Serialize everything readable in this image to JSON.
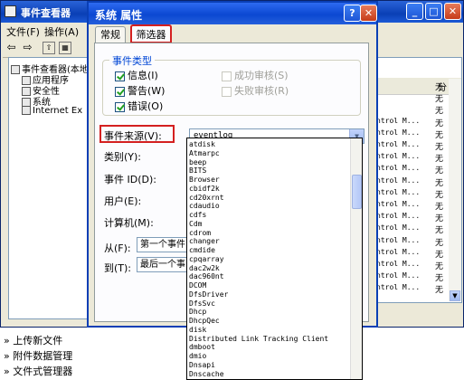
{
  "event_viewer": {
    "title": "事件查看器",
    "menu": [
      "文件(F)",
      "操作(A)"
    ],
    "tree": [
      "事件查看器(本地)",
      "应用程序",
      "安全性",
      "系统",
      "Internet Ex"
    ],
    "list_header": "分",
    "rows": [
      {
        "src": "",
        "cat": "无"
      },
      {
        "src": "",
        "cat": "无"
      },
      {
        "src": "",
        "cat": "无"
      },
      {
        "src": "ntrol M...",
        "cat": "无"
      },
      {
        "src": "ntrol M...",
        "cat": "无"
      },
      {
        "src": "ntrol M...",
        "cat": "无"
      },
      {
        "src": "ntrol M...",
        "cat": "无"
      },
      {
        "src": "ntrol M...",
        "cat": "无"
      },
      {
        "src": "ntrol M...",
        "cat": "无"
      },
      {
        "src": "ntrol M...",
        "cat": "无"
      },
      {
        "src": "ntrol M...",
        "cat": "无"
      },
      {
        "src": "ntrol M...",
        "cat": "无"
      },
      {
        "src": "ntrol M...",
        "cat": "无"
      },
      {
        "src": "ntrol M...",
        "cat": "无"
      },
      {
        "src": "ntrol M...",
        "cat": "无"
      },
      {
        "src": "ntrol M...",
        "cat": "无"
      },
      {
        "src": "ntrol M...",
        "cat": "无"
      },
      {
        "src": "ntrol M...",
        "cat": "无"
      }
    ],
    "bottom_items": [
      "上传新文件",
      "附件数据管理",
      "文件式管理器"
    ]
  },
  "dialog": {
    "title": "系统 属性",
    "tabs": [
      "常规",
      "筛选器"
    ],
    "group_label": "事件类型",
    "checkboxes": [
      {
        "label": "信息(I)",
        "checked": true
      },
      {
        "label": "警告(W)",
        "checked": true
      },
      {
        "label": "错误(O)",
        "checked": true
      },
      {
        "label": "成功审核(S)",
        "checked": false
      },
      {
        "label": "失败审核(R)",
        "checked": false
      }
    ],
    "source_label": "事件来源(V):",
    "source_value": "eventlog",
    "category_label": "类别(Y):",
    "event_id_label": "事件 ID(D):",
    "user_label": "用户(E):",
    "computer_label": "计算机(M):",
    "from_label": "从(F):",
    "from_value": "第一个事件",
    "to_label": "到(T):",
    "to_value": "最后一个事"
  },
  "source_list": [
    "atdisk",
    "Atmarpc",
    "beep",
    "BITS",
    "Browser",
    "cbidf2k",
    "cd20xrnt",
    "cdaudio",
    "cdfs",
    "Cdm",
    "cdrom",
    "changer",
    "cmdide",
    "cpqarray",
    "dac2w2k",
    "dac960nt",
    "DCOM",
    "DfsDriver",
    "DfsSvc",
    "Dhcp",
    "DhcpQec",
    "disk",
    "Distributed Link Tracking Client",
    "dmboot",
    "dmio",
    "Dnsapi",
    "Dnscache"
  ]
}
